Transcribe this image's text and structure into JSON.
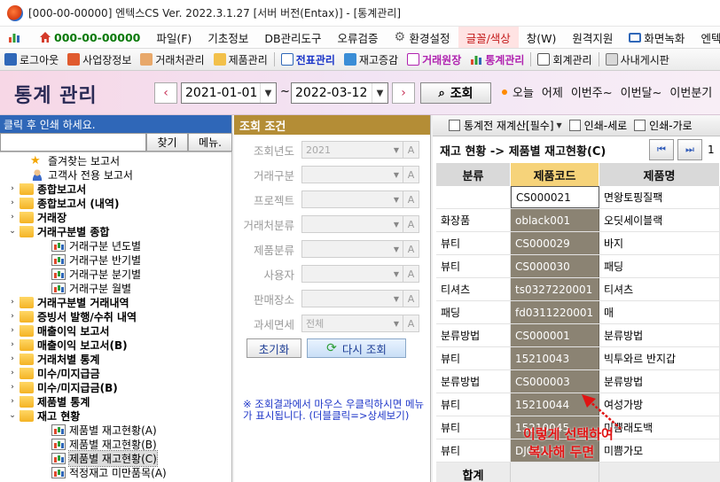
{
  "window": {
    "title": "[000-00-00000] 엔텍스CS Ver. 2022.3.1.27 [서버 버전(Entax)] - [통계관리]"
  },
  "menubar": {
    "items": [
      "000-00-00000",
      "파일(F)",
      "기초정보",
      "DB관리도구",
      "오류검증",
      "환경설정",
      "글꼴/색상",
      "창(W)",
      "원격지원",
      "화면녹화",
      "엔텍스C"
    ]
  },
  "toolbar": {
    "items": [
      "로그아웃",
      "사업장정보",
      "거래처관리",
      "제품관리",
      "전표관리",
      "재고증감",
      "거래원장",
      "통계관리",
      "회계관리",
      "사내게시판"
    ]
  },
  "header": {
    "title": "통계 관리",
    "date_from": "2021-01-01",
    "date_to": "2022-03-12",
    "tilde": "~",
    "search_label": "조회",
    "periods": [
      "오늘",
      "어제",
      "이번주~",
      "이번달~",
      "이번분기"
    ]
  },
  "left": {
    "heading": "클릭 후 인쇄 하세요.",
    "find_label": "찾기",
    "menu_label": "메뉴.",
    "tree": [
      {
        "label": "즐겨찾는 보고서",
        "type": "star",
        "depth": 1,
        "bold": false
      },
      {
        "label": "고객사 전용 보고서",
        "type": "person",
        "depth": 1,
        "bold": false
      },
      {
        "label": "종합보고서",
        "type": "folder",
        "depth": 0,
        "toggle": "›",
        "bold": true
      },
      {
        "label": "종합보고서 (내역)",
        "type": "folder",
        "depth": 0,
        "toggle": "›",
        "bold": true
      },
      {
        "label": "거래장",
        "type": "folder",
        "depth": 0,
        "toggle": "›",
        "bold": true
      },
      {
        "label": "거래구분별 종합",
        "type": "folder",
        "depth": 0,
        "toggle": "⌄",
        "bold": true
      },
      {
        "label": "거래구분 년도별",
        "type": "report",
        "depth": 2,
        "bold": false
      },
      {
        "label": "거래구분 반기별",
        "type": "report",
        "depth": 2,
        "bold": false
      },
      {
        "label": "거래구분 분기별",
        "type": "report",
        "depth": 2,
        "bold": false
      },
      {
        "label": "거래구분 월별",
        "type": "report",
        "depth": 2,
        "bold": false
      },
      {
        "label": "거래구분별 거래내역",
        "type": "folder",
        "depth": 0,
        "toggle": "›",
        "bold": true
      },
      {
        "label": "증빙서 발행/수취 내역",
        "type": "folder",
        "depth": 0,
        "toggle": "›",
        "bold": true
      },
      {
        "label": "매출이익 보고서",
        "type": "folder",
        "depth": 0,
        "toggle": "›",
        "bold": true
      },
      {
        "label": "매출이익 보고서(B)",
        "type": "folder",
        "depth": 0,
        "toggle": "›",
        "bold": true
      },
      {
        "label": "거래처별 통계",
        "type": "folder",
        "depth": 0,
        "toggle": "›",
        "bold": true
      },
      {
        "label": "미수/미지급금",
        "type": "folder",
        "depth": 0,
        "toggle": "›",
        "bold": true
      },
      {
        "label": "미수/미지급금(B)",
        "type": "folder",
        "depth": 0,
        "toggle": "›",
        "bold": true
      },
      {
        "label": "제품별 통계",
        "type": "folder",
        "depth": 0,
        "toggle": "›",
        "bold": true
      },
      {
        "label": "재고 현황",
        "type": "folder",
        "depth": 0,
        "toggle": "⌄",
        "bold": true
      },
      {
        "label": "제품별 재고현황(A)",
        "type": "report",
        "depth": 2,
        "bold": false
      },
      {
        "label": "제품별 재고현황(B)",
        "type": "report",
        "depth": 2,
        "bold": false
      },
      {
        "label": "제품별 재고현황(C)",
        "type": "report",
        "depth": 2,
        "bold": false,
        "selected": true
      },
      {
        "label": "적정재고 미만품목(A)",
        "type": "report",
        "depth": 2,
        "bold": false
      }
    ]
  },
  "middle": {
    "heading": "조회 조건",
    "conditions": [
      {
        "label": "조회년도",
        "value": "2021"
      },
      {
        "label": "거래구분",
        "value": ""
      },
      {
        "label": "프로젝트",
        "value": ""
      },
      {
        "label": "거래처분류",
        "value": ""
      },
      {
        "label": "제품분류",
        "value": ""
      },
      {
        "label": "사용자",
        "value": ""
      },
      {
        "label": "판매장소",
        "value": ""
      },
      {
        "label": "과세면세",
        "value": "전체"
      }
    ],
    "field_suffix": "A",
    "reset_label": "초기화",
    "requery_label": "다시 조회",
    "note": "※ 조회결과에서 마우스 우클릭하시면 메뉴가 표시됩니다. (더블클릭=>상세보기)"
  },
  "right": {
    "tools": [
      "통계전 재계산[필수]",
      "인쇄-세로",
      "인쇄-가로"
    ],
    "subtitle": "재고 현황 -> 제품별 재고현황(C)",
    "page": "1",
    "columns": [
      "분류",
      "제품코드",
      "제품명"
    ],
    "rows": [
      [
        "",
        "CS000021",
        "면왕토핑질팩"
      ],
      [
        "화장품",
        "oblack001",
        "오딧세이블랙"
      ],
      [
        "뷰티",
        "CS000029",
        "바지"
      ],
      [
        "뷰티",
        "CS000030",
        "패딩"
      ],
      [
        "티셔츠",
        "ts0327220001",
        "티셔츠"
      ],
      [
        "패딩",
        "fd0311220001",
        "매"
      ],
      [
        "분류방법",
        "CS000001",
        "분류방법"
      ],
      [
        "뷰티",
        "15210043",
        "빅투와르 반지갑"
      ],
      [
        "분류방법",
        "CS000003",
        "분류방법"
      ],
      [
        "뷰티",
        "15210044",
        "여성가방"
      ],
      [
        "뷰티",
        "15210045",
        "미쁨래도백"
      ],
      [
        "뷰티",
        "DJ001",
        "미쁨가모"
      ]
    ],
    "total_label": "합계",
    "annotation_line1": "이렇게 선택하여",
    "annotation_line2": "복사해 두면"
  }
}
